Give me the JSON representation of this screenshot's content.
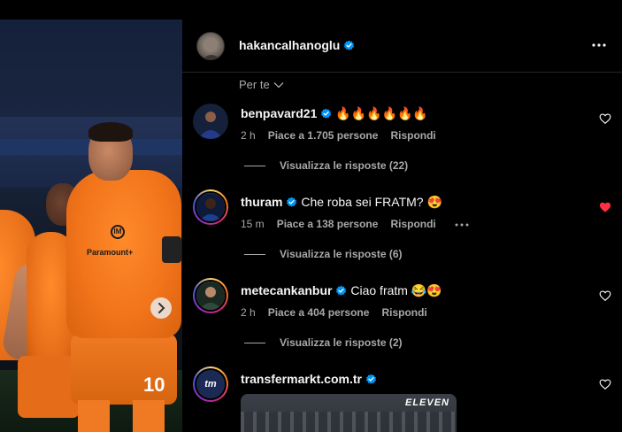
{
  "post": {
    "author": "hakancalhanoglu",
    "author_verified": true,
    "shirt_number": "10",
    "sponsor_text": "Paramount+",
    "crest_text": "IM",
    "image_watermark": "ELEVEN"
  },
  "sort": {
    "label": "Per te"
  },
  "comments": [
    {
      "username": "benpavard21",
      "verified": true,
      "text": "🔥🔥🔥🔥🔥🔥",
      "time": "2 h",
      "likes": "Piace a 1.705 persone",
      "reply_label": "Rispondi",
      "replies": "Visualizza le risposte (22)",
      "liked": false
    },
    {
      "username": "thuram",
      "verified": true,
      "text": "Che roba sei FRATM? 😍",
      "time": "15 m",
      "likes": "Piace a 138 persone",
      "reply_label": "Rispondi",
      "replies": "Visualizza le risposte (6)",
      "liked": true
    },
    {
      "username": "metecankanbur",
      "verified": true,
      "text": "Ciao fratm 😂😍",
      "time": "2 h",
      "likes": "Piace a 404 persone",
      "reply_label": "Rispondi",
      "replies": "Visualizza le risposte (2)",
      "liked": false
    },
    {
      "username": "transfermarkt.com.tr",
      "verified": true,
      "avatar_text": "tm",
      "text": "",
      "liked": false
    }
  ],
  "colors": {
    "verified_blue": "#0095f6",
    "liked_red": "#ff3040",
    "meta_gray": "#a8a8a8",
    "jersey_orange": "#f2741b"
  },
  "icons": {
    "more": "more-horizontal-icon",
    "chevron": "chevron-down-icon",
    "heart": "heart-icon",
    "verified": "verified-badge-icon",
    "next": "chevron-right-icon"
  }
}
